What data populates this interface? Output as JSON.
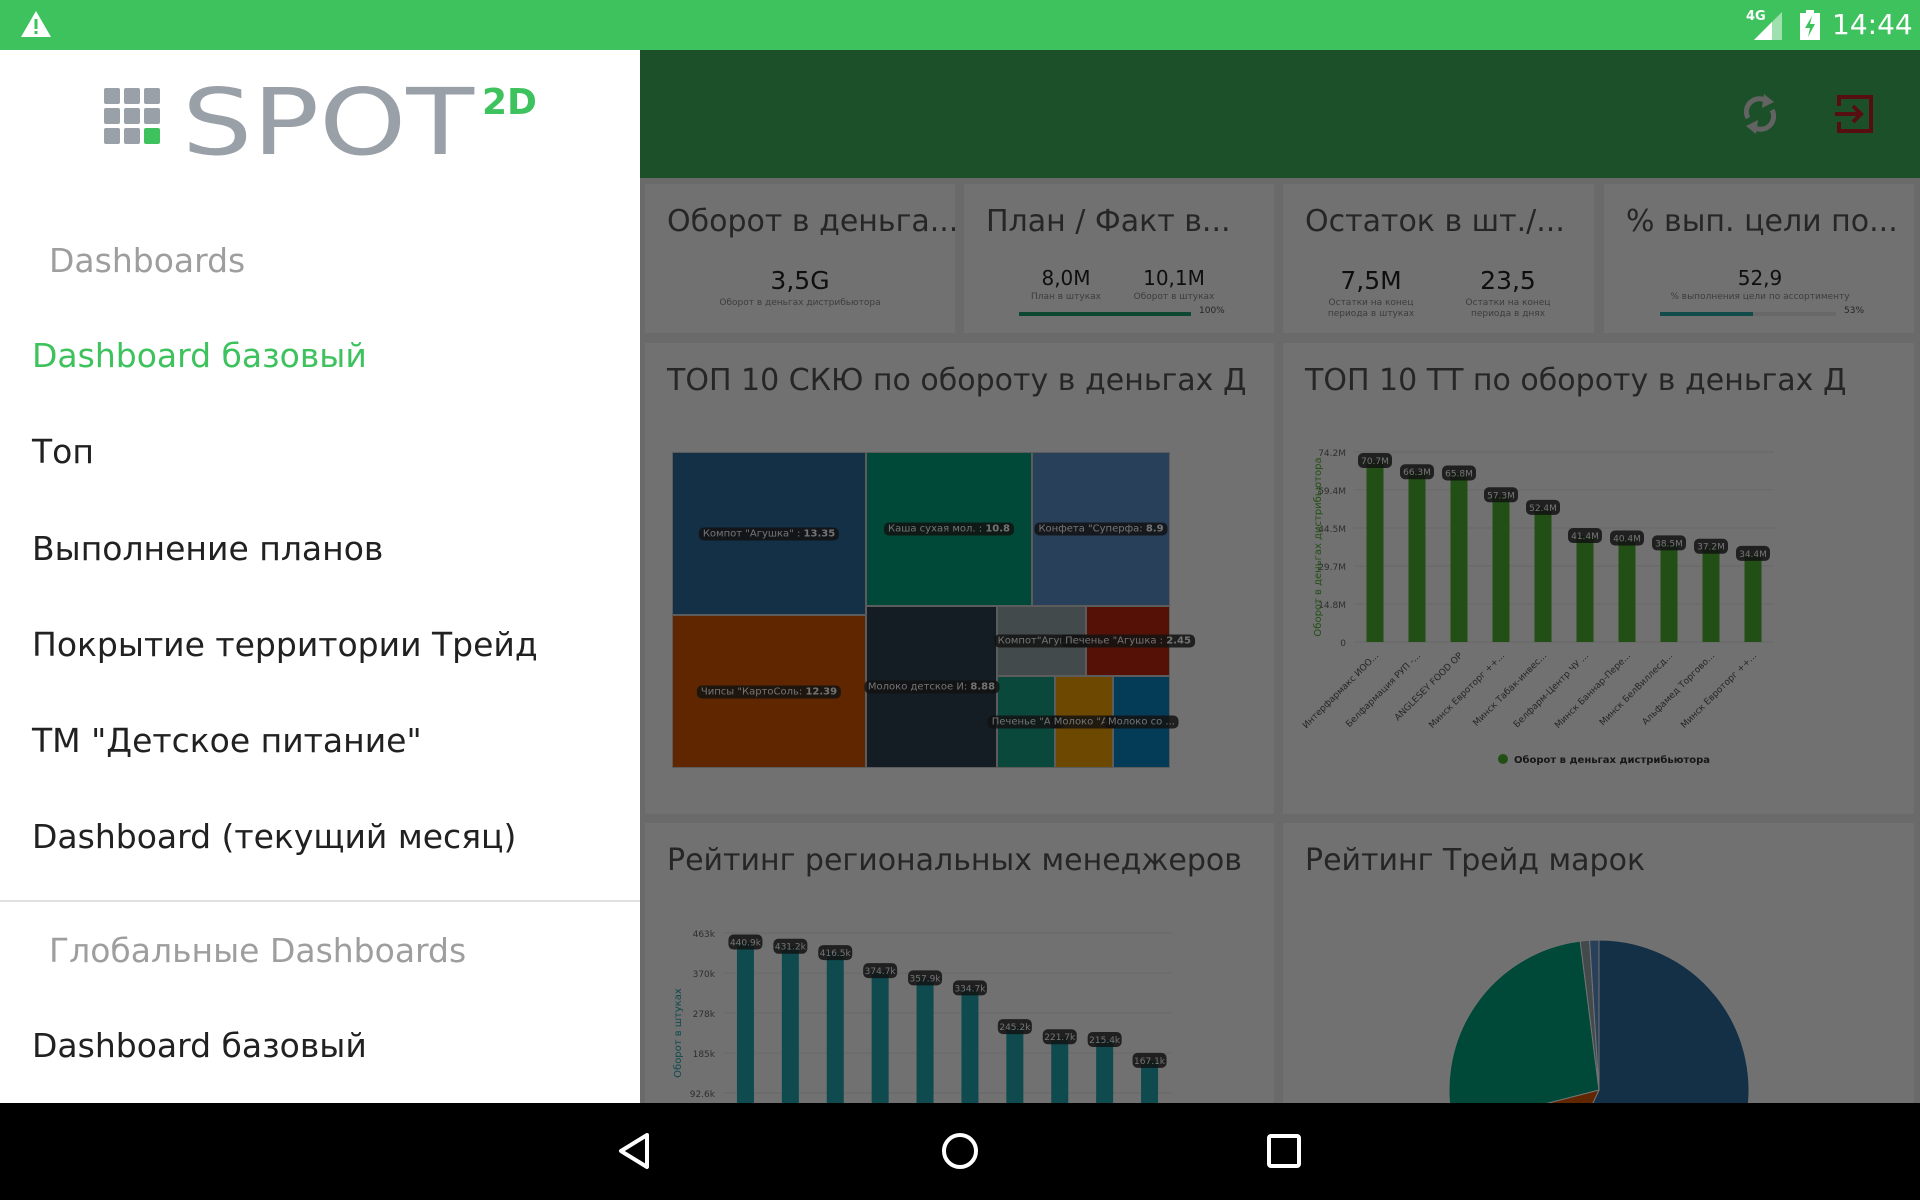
{
  "status_bar": {
    "network": "4G",
    "time": "14:44",
    "icons": [
      "warning-icon",
      "signal-icon",
      "battery-charging-icon"
    ]
  },
  "app_bar": {
    "icons": [
      "sync-icon",
      "logout-icon"
    ]
  },
  "logo": {
    "text": "SPOT",
    "superscript": "2D",
    "accent": "#3ec25d",
    "gray": "#9aa0a8"
  },
  "drawer": {
    "section1": "Dashboards",
    "items": [
      {
        "label": "Dashboard базовый",
        "active": true
      },
      {
        "label": "Топ"
      },
      {
        "label": "Выполнение планов"
      },
      {
        "label": "Покрытие территории Трейд"
      },
      {
        "label": "ТМ \"Детское питание\""
      },
      {
        "label": "Dashboard (текущий месяц)"
      }
    ],
    "section2": "Глобальные Dashboards",
    "global_items": [
      {
        "label": "Dashboard базовый"
      }
    ]
  },
  "kpis": [
    {
      "title": "Оборот в деньга...",
      "values": [
        {
          "value": "3,5G",
          "sub": "Оборот в деньгах дистрибьютора"
        }
      ]
    },
    {
      "title": "План / Факт в...",
      "values": [
        {
          "value": "8,0M",
          "sub": "План в штуках"
        },
        {
          "value": "10,1M",
          "sub": "Оборот в штуках"
        }
      ],
      "progress": 100,
      "progress_label": "100%",
      "color": "#1d9e6c"
    },
    {
      "title": "Остаток в шт./...",
      "values": [
        {
          "value": "7,5M",
          "sub": "Остатки на конец периода в штуках"
        },
        {
          "value": "23,5",
          "sub": "Остатки на конец периода в днях"
        }
      ]
    },
    {
      "title": "% вып. цели по...",
      "values": [
        {
          "value": "52,9",
          "sub": "% выполнения цели по ассортименту"
        }
      ],
      "progress": 53,
      "progress_label": "53%",
      "color": "#2aa5a5"
    }
  ],
  "panels": {
    "treemap_title": "ТОП 10 СКЮ по обороту в деньгах Д",
    "tt_title": "ТОП 10 ТТ по обороту в деньгах Д",
    "managers_title": "Рейтинг региональных менеджеров",
    "brands_title": "Рейтинг Трейд марок"
  },
  "chart_data": [
    {
      "type": "treemap",
      "items": [
        {
          "label": "Компот \"Агушка\" : ",
          "value": 13.35,
          "color": "#2b6a9e"
        },
        {
          "label": "Чипсы \"КартоСоль: ",
          "value": 12.39,
          "color": "#d35400"
        },
        {
          "label": "Каша сухая мол. : ",
          "value": 10.8,
          "color": "#00a07a"
        },
        {
          "label": "Конфета \"Суперфа: ",
          "value": 8.9,
          "color": "#5a8fc8"
        },
        {
          "label": "Молоко детское И: ",
          "value": 8.88,
          "color": "#2c3e50"
        },
        {
          "label": "Компот\"Агушка\" ",
          "value": null,
          "color": "#95a5a6"
        },
        {
          "label": "Печенье \"Агушка : ",
          "value": 2.45,
          "color": "#c0260f"
        },
        {
          "label": "Печенье \"А...",
          "value": null,
          "color": "#16a085"
        },
        {
          "label": "Молоко \"А..",
          "value": null,
          "color": "#f0a000"
        },
        {
          "label": "Молоко со ...",
          "value": null,
          "color": "#0a85c4"
        }
      ]
    },
    {
      "type": "bar",
      "ylabel": "Оборот в деньгах дистрибьютора",
      "legend": "Оборот в деньгах дистрибьютора",
      "legend_placement": "bottom",
      "color": "#4caf2f",
      "yticks": [
        "0",
        "14.8M",
        "29.7M",
        "44.5M",
        "59.4M",
        "74.2M"
      ],
      "ylim": [
        0,
        74.2
      ],
      "categories": [
        "Интерфармакс ИОО...",
        "Белфармация РУП -...",
        "ANGLESEY FOOD ОР",
        "Минск Евроторг ++...",
        "Минск Табак-инвес...",
        "Белфарм-Центр ЧУ ...",
        "Минск Баннар-Пере...",
        "Минск БелВиллесд...",
        "Альфамед Торгово...",
        "Минск Евроторг ++..."
      ],
      "values": [
        70.7,
        66.3,
        65.8,
        57.3,
        52.4,
        41.4,
        40.4,
        38.5,
        37.2,
        34.4
      ],
      "labels": [
        "70.7M",
        "66.3M",
        "65.8M",
        "57.3M",
        "52.4M",
        "41.4M",
        "40.4M",
        "38.5M",
        "37.2M",
        "34.4M"
      ]
    },
    {
      "type": "bar",
      "ylabel": "Оборот в штуках",
      "color": "#1fa5ad",
      "yticks": [
        "92.6k",
        "185k",
        "278k",
        "370k",
        "463k"
      ],
      "ylim": [
        0,
        463
      ],
      "values": [
        440.9,
        431.2,
        416.5,
        374.7,
        357.9,
        334.7,
        245.2,
        221.7,
        215.4,
        167.1
      ],
      "labels": [
        "440.9k",
        "431.2k",
        "416.5k",
        "374.7k",
        "357.9k",
        "334.7k",
        "245.2k",
        "221.7k",
        "215.4k",
        "167.1k"
      ]
    },
    {
      "type": "pie",
      "values": [
        57,
        14,
        27,
        1,
        1
      ],
      "colors": [
        "#2b6a9e",
        "#d35400",
        "#00a07a",
        "#95a5a6",
        "#5a8fc8"
      ]
    }
  ]
}
